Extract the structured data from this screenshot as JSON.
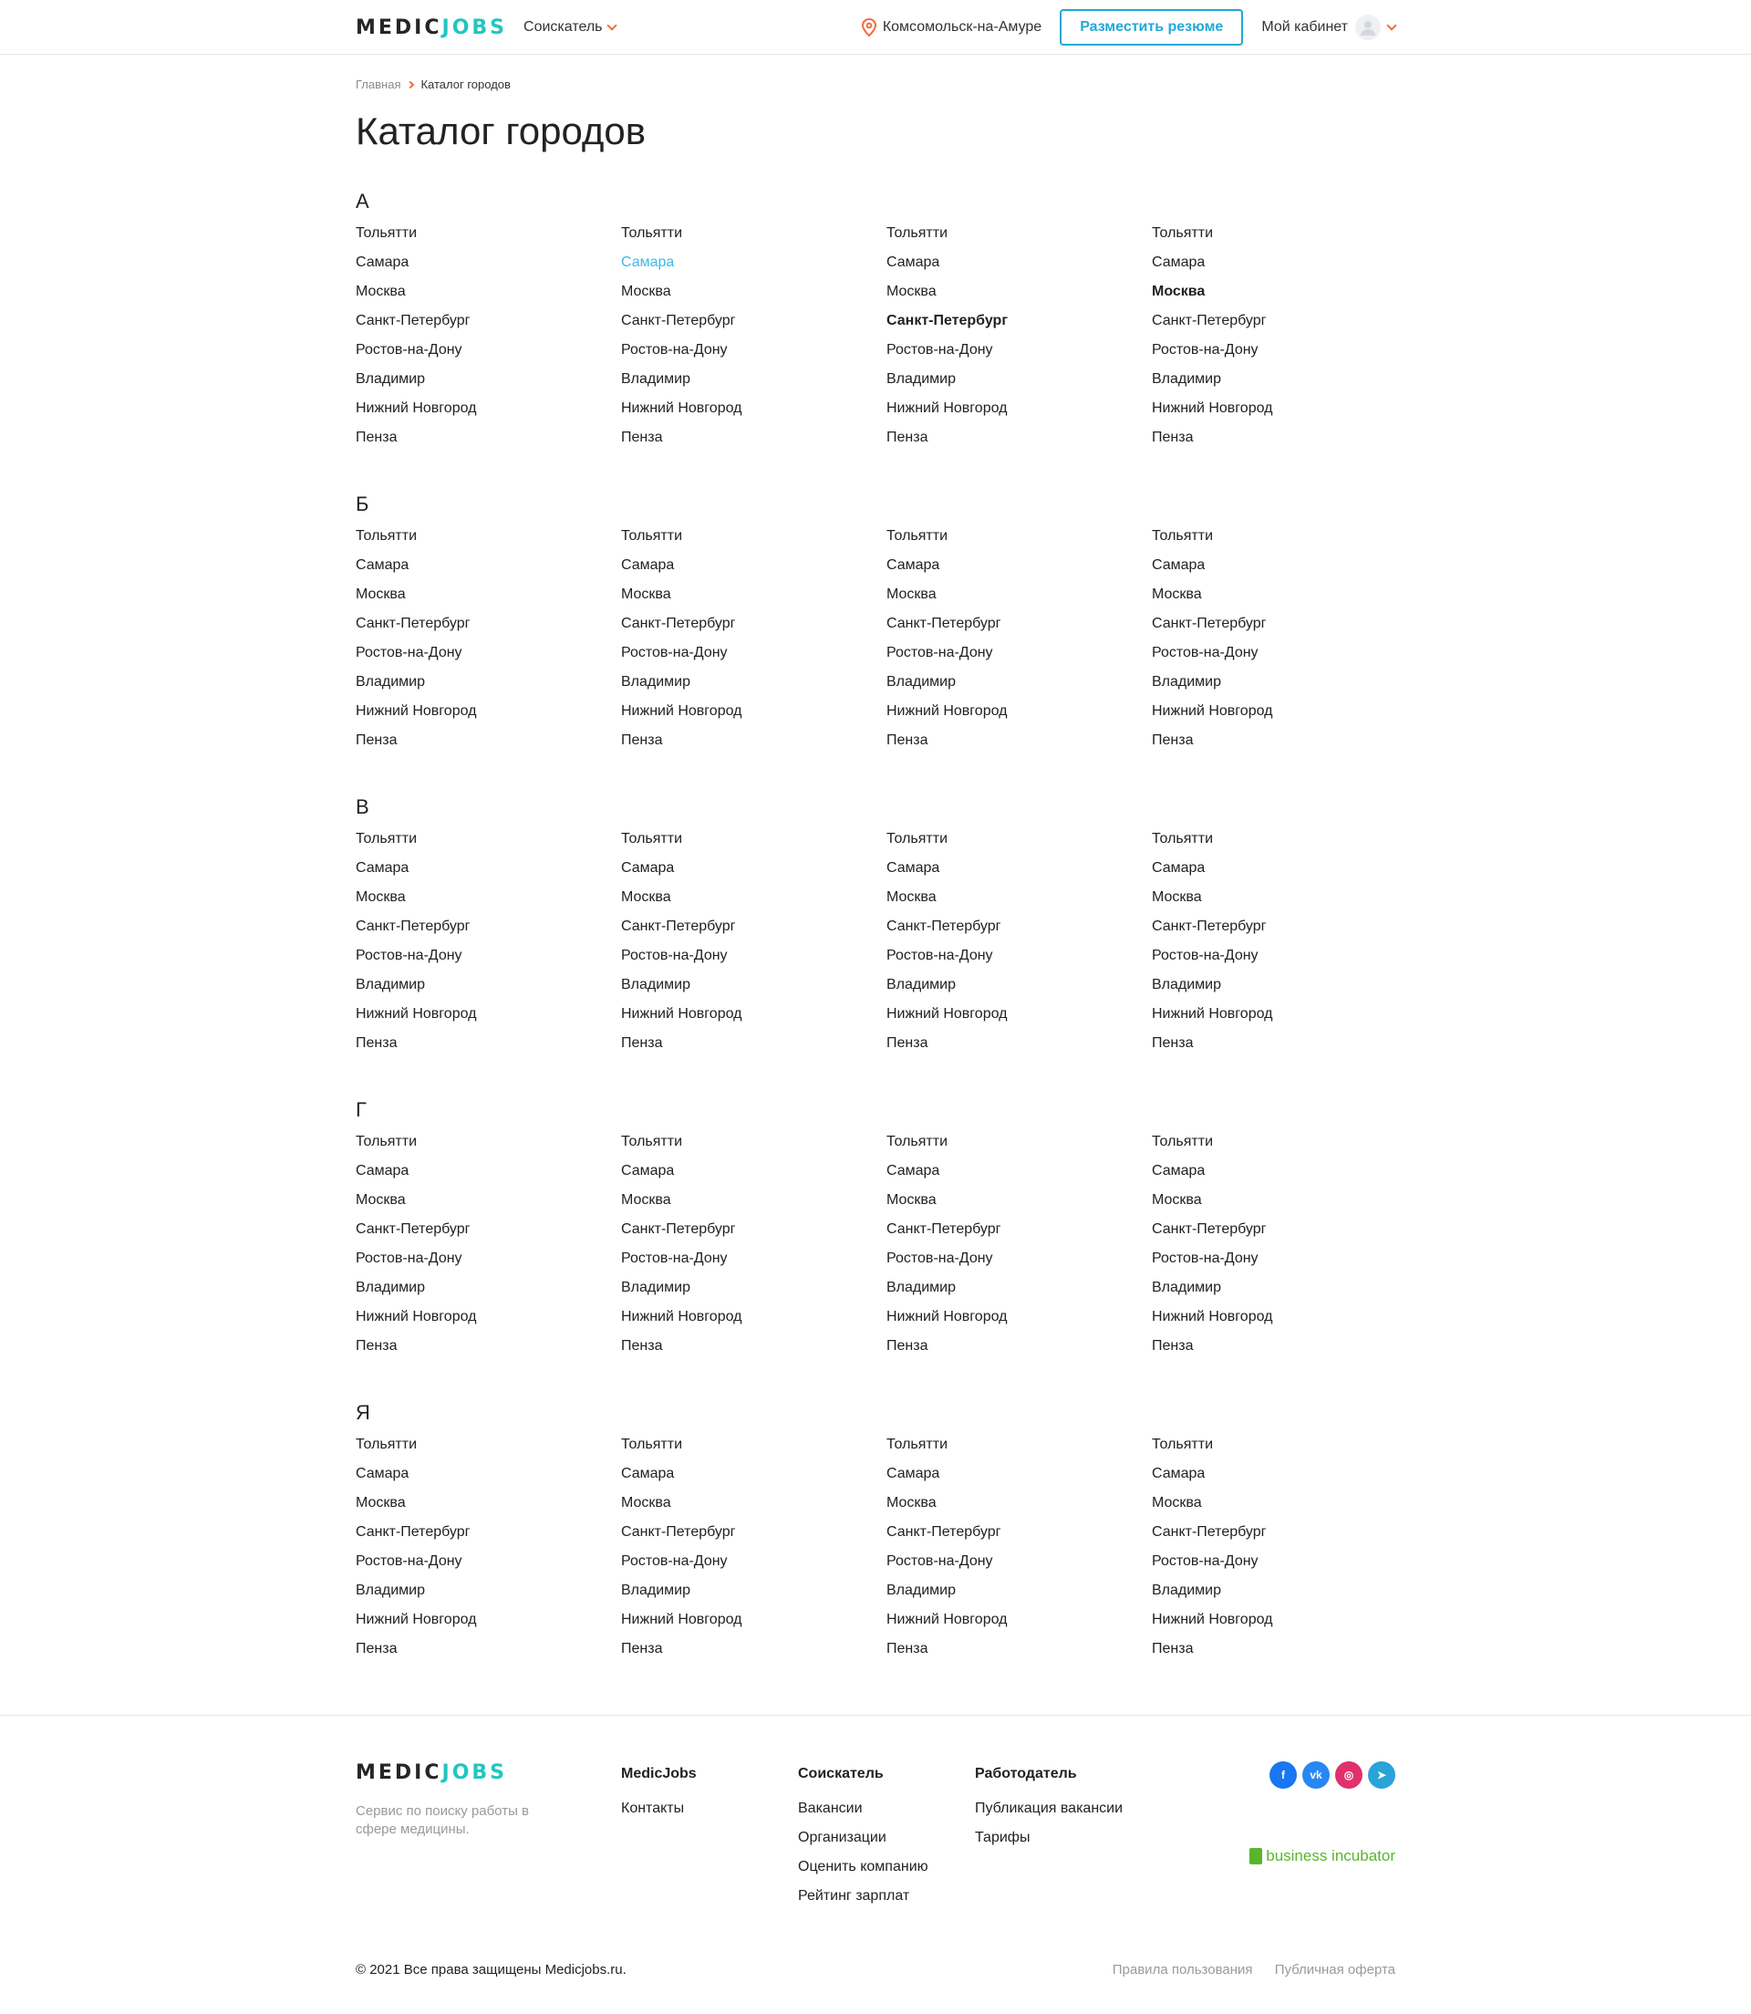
{
  "header": {
    "logo_medic": "MEDIC",
    "logo_jobs": "JOBS",
    "role": "Соискатель",
    "city": "Комсомольск-на-Амуре",
    "post_resume": "Разместить резюме",
    "cabinet": "Мой кабинет"
  },
  "breadcrumb": {
    "home": "Главная",
    "current": "Каталог городов"
  },
  "page_title": "Каталог городов",
  "catalog": {
    "letters": [
      "А",
      "Б",
      "В",
      "Г",
      "Я"
    ],
    "cities": [
      "Тольятти",
      "Самара",
      "Москва",
      "Санкт-Петербург",
      "Ростов-на-Дону",
      "Владимир",
      "Нижний Новгород",
      "Пенза"
    ]
  },
  "footer": {
    "logo_medic": "MEDIC",
    "logo_jobs": "JOBS",
    "tagline": "Сервис по поиску работы в сфере медицины.",
    "col1": {
      "title": "MedicJobs",
      "links": [
        "Контакты"
      ]
    },
    "col2": {
      "title": "Соискатель",
      "links": [
        "Вакансии",
        "Организации",
        "Оценить компанию",
        "Рейтинг зарплат"
      ]
    },
    "col3": {
      "title": "Работодатель",
      "links": [
        "Публикация вакансии",
        "Тарифы"
      ]
    },
    "social": [
      {
        "name": "facebook-icon",
        "glyph": "f",
        "color": "#1877f2"
      },
      {
        "name": "vk-icon",
        "glyph": "vk",
        "color": "#2787f5"
      },
      {
        "name": "instagram-icon",
        "glyph": "◎",
        "color": "#e1306c"
      },
      {
        "name": "telegram-icon",
        "glyph": "➤",
        "color": "#2aa3d8"
      }
    ],
    "incubator": "business incubator",
    "copyright": "© 2021 Все права защищены Medicjobs.ru.",
    "terms": "Правила пользования",
    "offer": "Публичная оферта"
  },
  "colors": {
    "accent": "#1fa9d6",
    "brand_teal": "#20c7c0",
    "orange": "#f26b3a",
    "active_link": "#3cb8e8"
  }
}
